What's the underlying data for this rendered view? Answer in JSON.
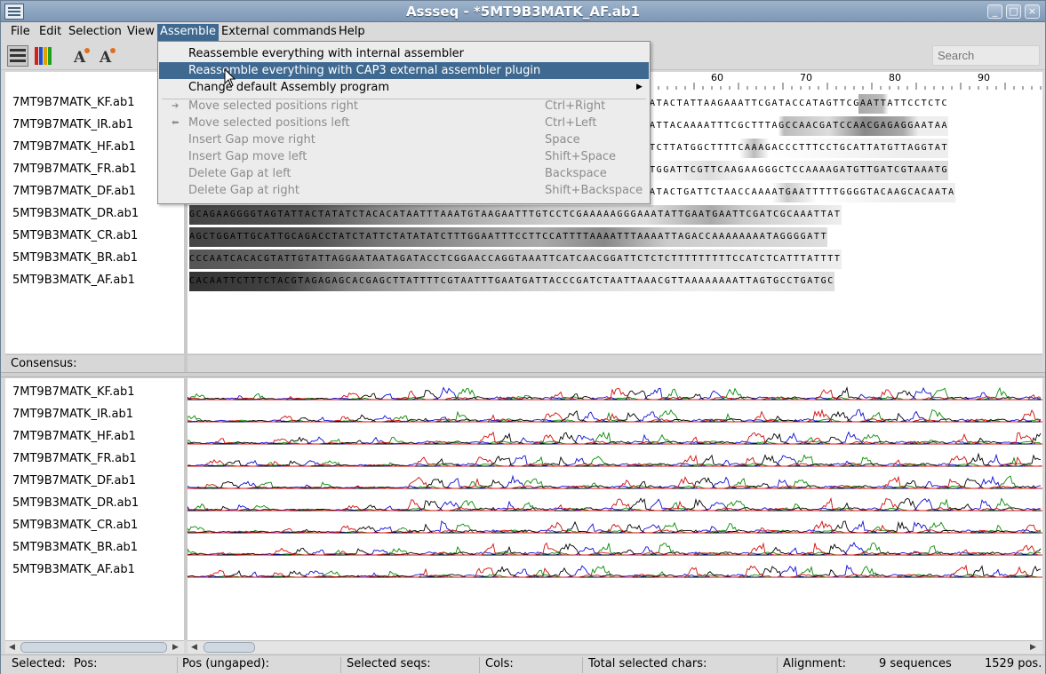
{
  "window": {
    "title": "Assseq - *5MT9B3MATK_AF.ab1"
  },
  "menubar": {
    "items": [
      "File",
      "Edit",
      "Selection",
      "View",
      "Assemble",
      "External commands",
      "Help"
    ]
  },
  "search": {
    "placeholder": "Search"
  },
  "ruler": {
    "labels": [
      "60",
      "70",
      "80",
      "90"
    ]
  },
  "sequences": {
    "names": [
      "7MT9B7MATK_KF.ab1",
      "7MT9B7MATK_IR.ab1",
      "7MT9B7MATK_HF.ab1",
      "7MT9B7MATK_FR.ab1",
      "7MT9B7MATK_DF.ab1",
      "5MT9B3MATK_DR.ab1",
      "5MT9B3MATK_CR.ab1",
      "5MT9B3MATK_BR.ab1",
      "5MT9B3MATK_AF.ab1"
    ],
    "bases": [
      "ATACTATTAAGAAATTCGATACCATAGTTCGAATTATTCCTCTC",
      "ATTACAAAATTTCGCTTTAGCCAACGATCCAACGAGAGGAATAA",
      "TCTTATGGCTTTTCAAAGACCCTTTCCTGCATTATGTTAGGTAT",
      "TGGATTCGTTCAAGAAGGGCTCCAAAAGATGTTGATCGTAAATG",
      "ATACTGATTCTAACCAAAATGAATTTTTGGGGTACAAGCACAATA",
      "GCAGAAGGGGTAGTATTACTATATCTACACATAATTTAAATGTAAGAATTTGTCCTCGAAAAAGGGAAATATTGAATGAATTCGATCGCAAATTAT",
      "AGCTGGATTGCATTGCAGACCTATCTATTCTATATATCTTTGGAATTTCCTTCCATTTTAAAATTTAAAATTAGACCAAAAAAAATAGGGGATT",
      "CCCAATCACACGTATTGTATTAGGAATAATAGATACCTCGGAACCAGGTAAATTCATCAACGGATTCTCTCTTTTTTTTTCCATCTCATTTATTTT",
      "CACAATTCTTTCTACGTAGAGAGCACGAGCTTATTTTCGTAATTTGAATGATTACCCGATCTAATTAAACGTTAAAAAAAATTAGTGCCTGATGC"
    ]
  },
  "consensus": {
    "label": "Consensus:"
  },
  "assemble_menu": {
    "items": [
      {
        "label": "Reassemble everything with internal assembler",
        "shortcut": ""
      },
      {
        "label": "Reassemble everything with CAP3 external assembler plugin",
        "shortcut": ""
      },
      {
        "label": "Change default Assembly program",
        "shortcut": ""
      },
      {
        "label": "Move selected positions right",
        "shortcut": "Ctrl+Right"
      },
      {
        "label": "Move selected positions left",
        "shortcut": "Ctrl+Left"
      },
      {
        "label": "Insert Gap move right",
        "shortcut": "Space"
      },
      {
        "label": "Insert Gap move left",
        "shortcut": "Shift+Space"
      },
      {
        "label": "Delete Gap at left",
        "shortcut": "Backspace"
      },
      {
        "label": "Delete Gap at right",
        "shortcut": "Shift+Backspace"
      }
    ]
  },
  "status": {
    "selected": "Selected:",
    "pos": "Pos:",
    "pos_ungaped": "Pos (ungaped):",
    "selected_seqs": "Selected seqs:",
    "cols": "Cols:",
    "total": "Total selected chars:",
    "alignment": "Alignment:",
    "sequences": "9 sequences",
    "positions": "1529 pos."
  },
  "colors": {
    "accent": "#3f6990",
    "trace_a": "#0a8a0a",
    "trace_c": "#1010d0",
    "trace_g": "#000000",
    "trace_t": "#d01010"
  }
}
